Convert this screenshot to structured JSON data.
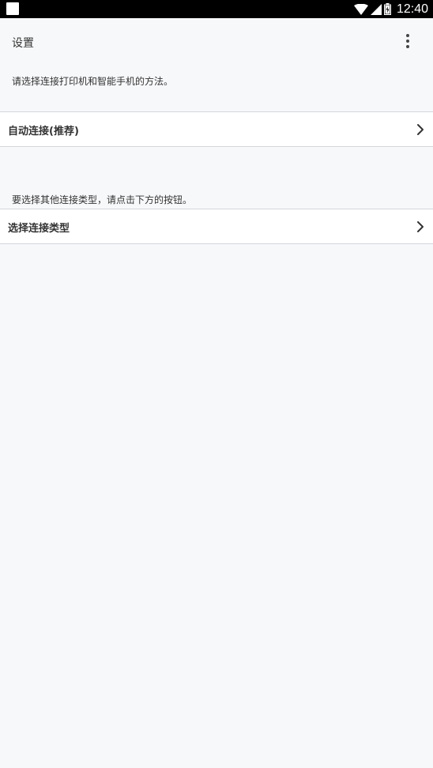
{
  "status_bar": {
    "time": "12:40",
    "icons": [
      "wifi-icon",
      "signal-icon",
      "battery-icon"
    ]
  },
  "header": {
    "title": "设置",
    "menu_icon": "more-vert-icon"
  },
  "intro_text": "请选择连接打印机和智能手机的方法。",
  "auto_connect": {
    "label": "自动连接(推荐)",
    "icon": "chevron-right-icon"
  },
  "other_text": "要选择其他连接类型，请点击下方的按钮。",
  "select_connection": {
    "label": "选择连接类型",
    "icon": "chevron-right-icon"
  },
  "colors": {
    "background": "#f7f8fa",
    "row_background": "#ffffff",
    "divider": "#d4d6da",
    "text": "#333333",
    "status_bar": "#000000"
  }
}
